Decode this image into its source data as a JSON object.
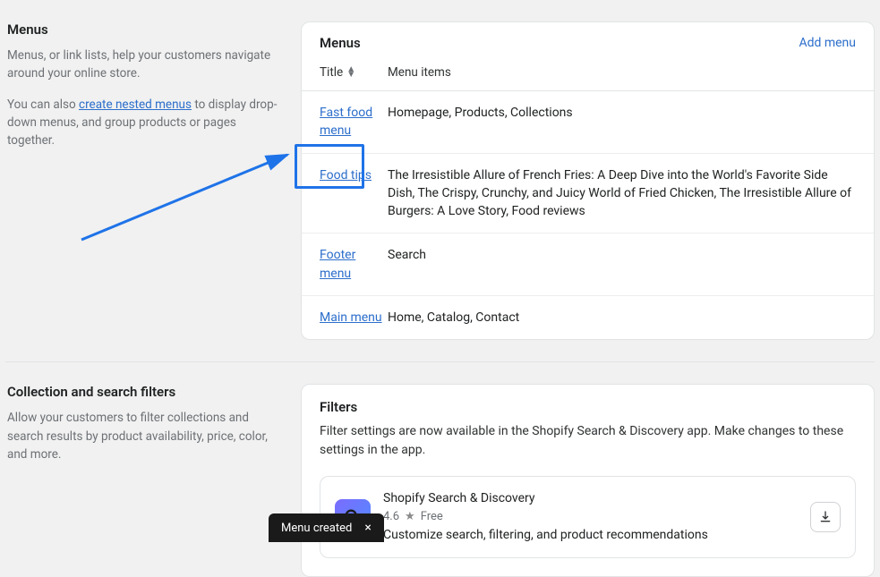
{
  "menus_section": {
    "heading": "Menus",
    "desc": "Menus, or link lists, help your customers navigate around your online store.",
    "extra_before": "You can also ",
    "extra_link": "create nested menus",
    "extra_after": " to display drop-down menus, and group products or pages together."
  },
  "menus_card": {
    "heading": "Menus",
    "add_label": "Add menu",
    "col_title": "Title",
    "col_items": "Menu items",
    "rows": [
      {
        "title": "Fast food menu",
        "items": "Homepage, Products, Collections"
      },
      {
        "title": "Food tips",
        "items": "The Irresistible Allure of French Fries: A Deep Dive into the World's Favorite Side Dish, The Crispy, Crunchy, and Juicy World of Fried Chicken, The Irresistible Allure of Burgers: A Love Story, Food reviews"
      },
      {
        "title": "Footer menu",
        "items": "Search"
      },
      {
        "title": "Main menu",
        "items": "Home, Catalog, Contact"
      }
    ]
  },
  "filters_section": {
    "heading": "Collection and search filters",
    "desc": "Allow your customers to filter collections and search results by product availability, price, color, and more."
  },
  "filters_card": {
    "heading": "Filters",
    "desc": "Filter settings are now available in the Shopify Search & Discovery app. Make changes to these settings in the app.",
    "app_name": "Shopify Search & Discovery",
    "app_rating": "4.6",
    "app_free": "Free",
    "app_desc": "Customize search, filtering, and product recommendations"
  },
  "toast": {
    "label": "Menu created",
    "close": "×"
  }
}
